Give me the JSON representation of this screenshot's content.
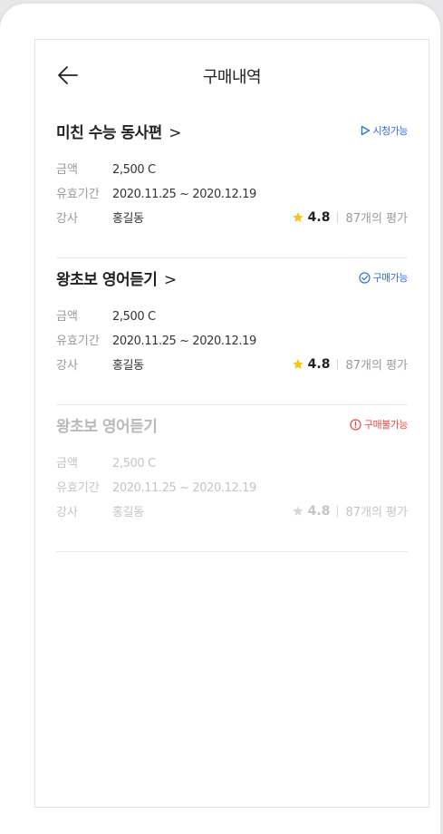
{
  "header": {
    "title": "구매내역"
  },
  "items": [
    {
      "title": "미친 수능 동사편",
      "arrow": ">",
      "status": "시청가능",
      "status_color": "#2f6fe4",
      "status_icon": "play-outline-icon",
      "amount_label": "금액",
      "amount": "2,500 C",
      "period_label": "유효기간",
      "period": "2020.11.25 ~ 2020.12.19",
      "teacher_label": "강사",
      "teacher": "홍길동",
      "rating": "4.8",
      "reviews": "87개의 평가"
    },
    {
      "title": "왕초보 영어듣기",
      "arrow": ">",
      "status": "구매가능",
      "status_color": "#2f6fe4",
      "status_icon": "check-circle-icon",
      "amount_label": "금액",
      "amount": "2,500 C",
      "period_label": "유효기간",
      "period": "2020.11.25 ~ 2020.12.19",
      "teacher_label": "강사",
      "teacher": "홍길동",
      "rating": "4.8",
      "reviews": "87개의 평가"
    },
    {
      "title": "왕초보 영어듣기",
      "arrow": "",
      "status": "구매불가능",
      "status_color": "#e84a4a",
      "status_icon": "alert-circle-icon",
      "amount_label": "금액",
      "amount": "2,500 C",
      "period_label": "유효기간",
      "period": "2020.11.25 ~ 2020.12.19",
      "teacher_label": "강사",
      "teacher": "홍길동",
      "rating": "4.8",
      "reviews": "87개의 평가"
    }
  ],
  "colors": {
    "star_active": "#f7c514",
    "star_inactive": "#d9d9d9"
  }
}
